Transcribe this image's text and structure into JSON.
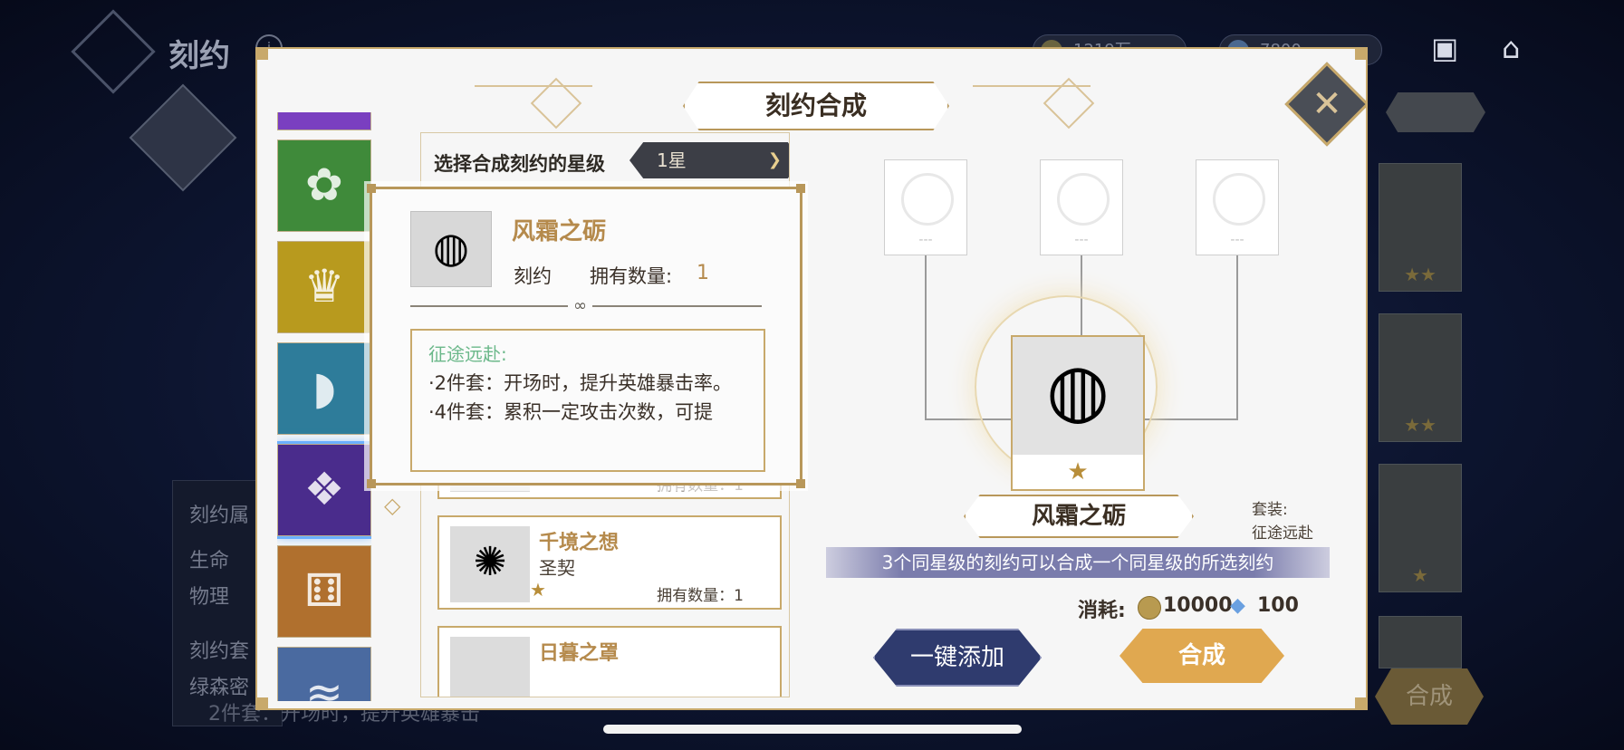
{
  "background": {
    "title": "刻约",
    "res1": "1219万",
    "res2": "7800",
    "bottom_text": "2件套：开场时，提升英雄暴击",
    "panel_lines": [
      "刻约属",
      "生命",
      "物理",
      "刻约套",
      "绿森密"
    ],
    "combine_label": "合成"
  },
  "modal": {
    "title": "刻约合成",
    "close_icon": "close-icon"
  },
  "thumbnails": [
    {
      "color": "#7a3fc0",
      "icon": "purple-item"
    },
    {
      "color": "#3f8a3a",
      "icon": "flower-item",
      "glyph": "✿"
    },
    {
      "color": "#b89a1e",
      "icon": "crown-item",
      "glyph": "♛"
    },
    {
      "color": "#2e7c9a",
      "icon": "shell-item",
      "glyph": "◗"
    },
    {
      "color": "#4a2c8c",
      "icon": "mask-item",
      "glyph": "❖",
      "selected": true
    },
    {
      "color": "#b0702e",
      "icon": "dice-item",
      "glyph": "⚅"
    },
    {
      "color": "#4a6aa0",
      "icon": "wave-item",
      "glyph": "≈"
    }
  ],
  "list": {
    "star_label": "选择合成刻约的星级",
    "star_value": "1星",
    "items": [
      {
        "name": "",
        "type": "",
        "star": "★",
        "owned": "拥有数量：1",
        "glyph": ""
      },
      {
        "name": "千境之想",
        "type": "圣契",
        "star": "★",
        "owned": "拥有数量：1",
        "glyph": "✺"
      },
      {
        "name": "日暮之罩",
        "type": "",
        "star": "",
        "owned": "",
        "glyph": ""
      }
    ]
  },
  "tooltip": {
    "name": "风霜之砺",
    "type": "刻约",
    "owned_label": "拥有数量:",
    "owned_value": "1",
    "divider_mark": "∞",
    "set_name": "征途远赴:",
    "line1": "·2件套：开场时，提升英雄暴击率。",
    "line2": "·4件套：累积一定攻击次数，可提"
  },
  "synthesis": {
    "slot_placeholder": "---",
    "result_name": "风霜之砺",
    "result_star": "★",
    "suit_label": "套装:",
    "suit_value": "征途远赴",
    "info": "3个同星级的刻约可以合成一个同星级的所选刻约",
    "cost_label": "消耗:",
    "cost_gold": "10000",
    "cost_gem": "100",
    "add_button": "一键添加",
    "combine_button": "合成"
  }
}
